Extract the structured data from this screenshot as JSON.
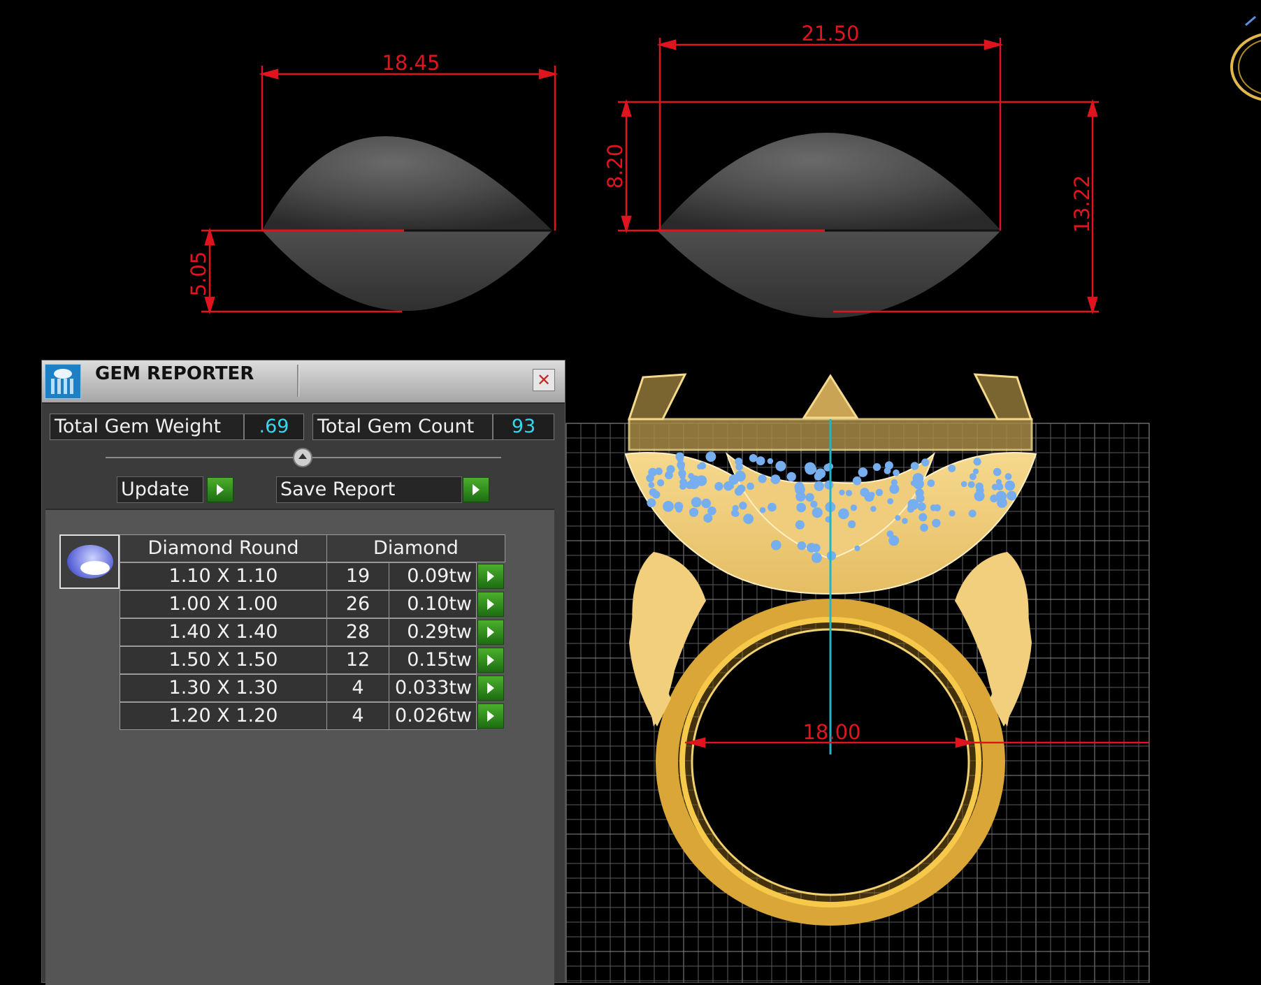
{
  "viewport": {
    "dimensions": {
      "stone_left_width": "18.45",
      "stone_left_height": "5.05",
      "stone_right_width": "21.50",
      "stone_right_crown": "8.20",
      "stone_right_total": "13.22",
      "ring_diameter": "18.00"
    },
    "colors": {
      "dimension": "#e0141e",
      "metal": "#f2cf7c",
      "gems": "#77aef0",
      "grid": "#5c5c5c"
    }
  },
  "gem_reporter": {
    "title": "GEM REPORTER",
    "total_weight_label": "Total Gem Weight",
    "total_weight_value": ".69",
    "total_count_label": "Total Gem Count",
    "total_count_value": "93",
    "update_label": "Update",
    "save_report_label": "Save Report",
    "table": {
      "header": {
        "shape": "Diamond Round",
        "material": "Diamond"
      },
      "rows": [
        {
          "size": "1.10 X 1.10",
          "count": "19",
          "weight": "0.09tw"
        },
        {
          "size": "1.00 X 1.00",
          "count": "26",
          "weight": "0.10tw"
        },
        {
          "size": "1.40 X 1.40",
          "count": "28",
          "weight": "0.29tw"
        },
        {
          "size": "1.50 X 1.50",
          "count": "12",
          "weight": "0.15tw"
        },
        {
          "size": "1.30 X 1.30",
          "count": "4",
          "weight": "0.033tw"
        },
        {
          "size": "1.20 X 1.20",
          "count": "4",
          "weight": "0.026tw"
        }
      ]
    }
  }
}
